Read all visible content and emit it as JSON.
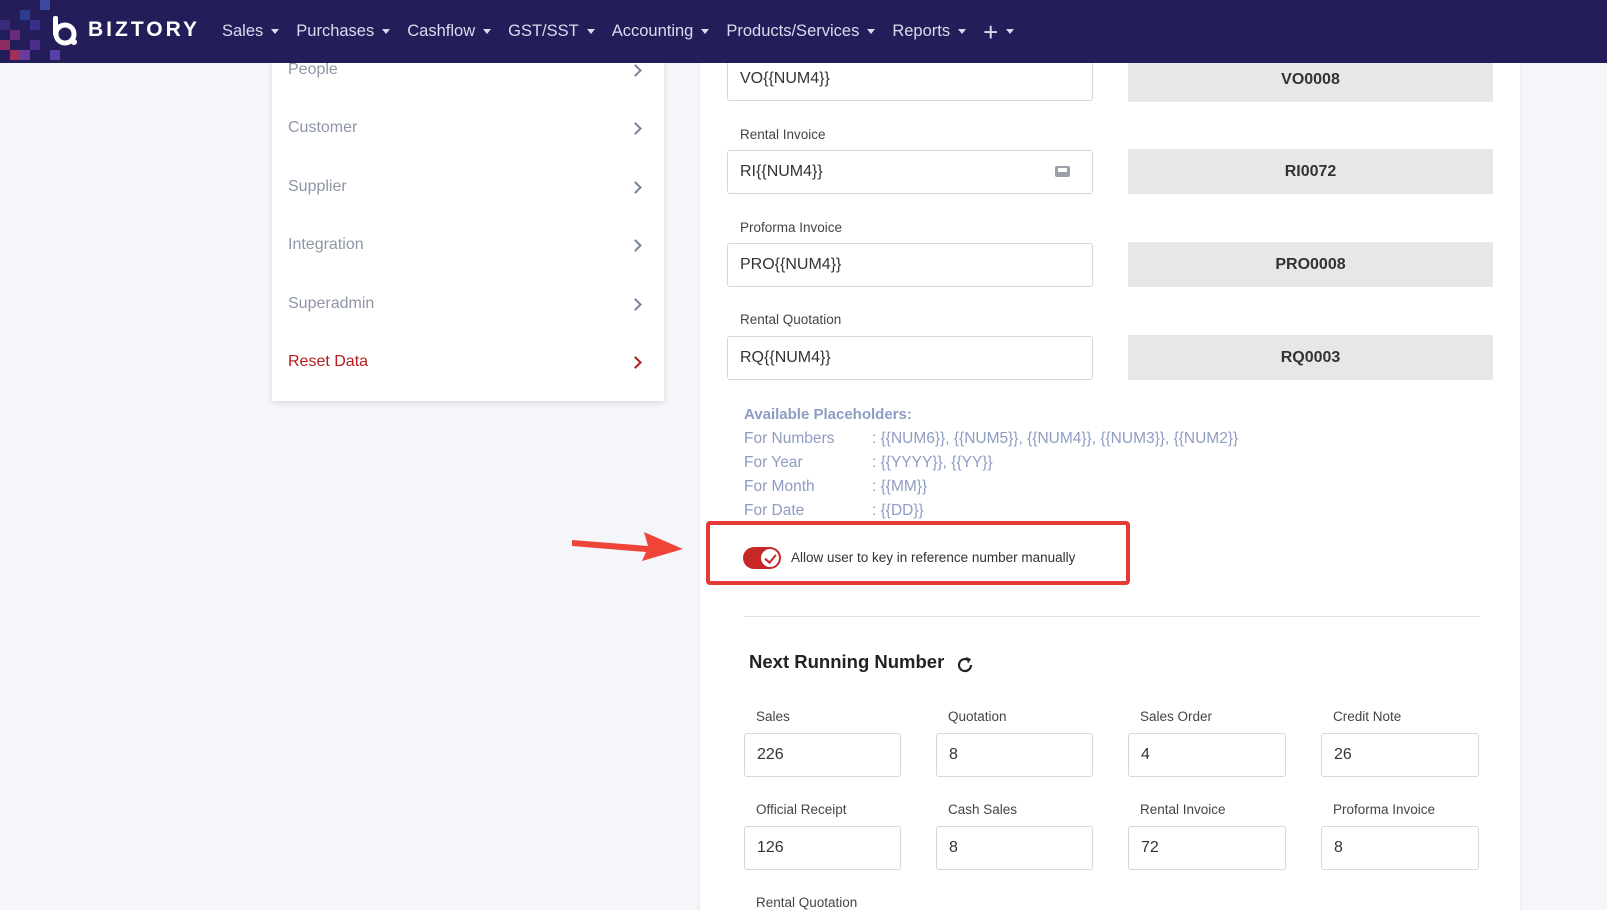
{
  "nav": {
    "brand": "BIZTORY",
    "items": [
      "Sales",
      "Purchases",
      "Cashflow",
      "GST/SST",
      "Accounting",
      "Products/Services",
      "Reports"
    ]
  },
  "sidebar": {
    "items": [
      {
        "label": "People"
      },
      {
        "label": "Customer"
      },
      {
        "label": "Supplier"
      },
      {
        "label": "Integration"
      },
      {
        "label": "Superadmin"
      },
      {
        "label": "Reset Data"
      }
    ]
  },
  "formats": {
    "voucher": {
      "value": "VO{{NUM4}}",
      "preview": "VO0008"
    },
    "rental_invoice": {
      "label": "Rental Invoice",
      "value": "RI{{NUM4}}",
      "preview": "RI0072"
    },
    "proforma_invoice": {
      "label": "Proforma Invoice",
      "value": "PRO{{NUM4}}",
      "preview": "PRO0008"
    },
    "rental_quotation": {
      "label": "Rental Quotation",
      "value": "RQ{{NUM4}}",
      "preview": "RQ0003"
    }
  },
  "placeholders": {
    "title": "Available Placeholders:",
    "rows": [
      {
        "key": "For Numbers",
        "value": ": {{NUM6}}, {{NUM5}}, {{NUM4}}, {{NUM3}}, {{NUM2}}"
      },
      {
        "key": "For Year",
        "value": ": {{YYYY}}, {{YY}}"
      },
      {
        "key": "For Month",
        "value": ": {{MM}}"
      },
      {
        "key": "For Date",
        "value": ": {{DD}}"
      }
    ]
  },
  "manual_toggle": {
    "label": "Allow user to key in reference number manually",
    "checked": true
  },
  "running": {
    "title": "Next Running Number",
    "fields": [
      {
        "label": "Sales",
        "value": "226"
      },
      {
        "label": "Quotation",
        "value": "8"
      },
      {
        "label": "Sales Order",
        "value": "4"
      },
      {
        "label": "Credit Note",
        "value": "26"
      },
      {
        "label": "Official Receipt",
        "value": "126"
      },
      {
        "label": "Cash Sales",
        "value": "8"
      },
      {
        "label": "Rental Invoice",
        "value": "72"
      },
      {
        "label": "Proforma Invoice",
        "value": "8"
      },
      {
        "label": "Rental Quotation",
        "value": ""
      }
    ]
  },
  "colors": {
    "navbar": "#231d5a",
    "accent_red": "#c62828",
    "placeholder_text": "#8e9cc4"
  }
}
